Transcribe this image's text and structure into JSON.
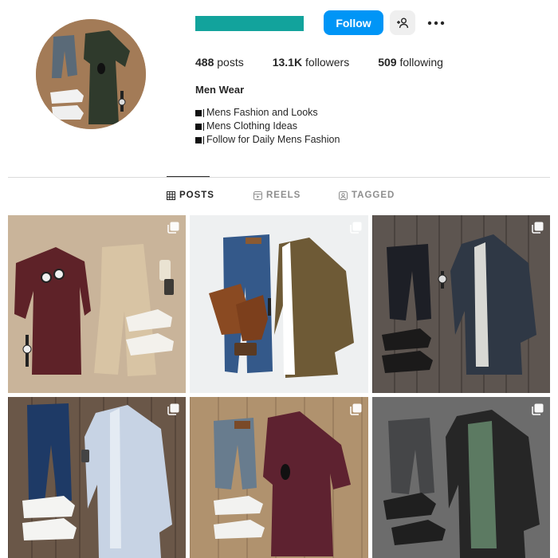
{
  "profile": {
    "username_redacted": true,
    "follow_label": "Follow",
    "stats": {
      "posts_value": "488",
      "posts_label": "posts",
      "followers_value": "13.1K",
      "followers_label": "followers",
      "following_value": "509",
      "following_label": "following"
    },
    "bio": {
      "name": "Men Wear",
      "lines": [
        "Mens Fashion and Looks",
        "Mens Clothing Ideas",
        "Follow for Daily Mens Fashion"
      ]
    }
  },
  "tabs": [
    {
      "label": "POSTS",
      "icon": "grid-icon",
      "active": true
    },
    {
      "label": "REELS",
      "icon": "reels-icon",
      "active": false
    },
    {
      "label": "TAGGED",
      "icon": "tagged-icon",
      "active": false
    }
  ],
  "posts": [
    {
      "icon": "multiple-photos-icon"
    },
    {
      "icon": "multiple-photos-icon"
    },
    {
      "icon": "multiple-photos-icon"
    },
    {
      "icon": "multiple-photos-icon"
    },
    {
      "icon": "multiple-photos-icon"
    },
    {
      "icon": "multiple-photos-icon"
    }
  ],
  "colors": {
    "accent": "#0095f6",
    "username_redaction": "#12a39c",
    "divider": "#dbdbdb",
    "muted_text": "#8e8e8e"
  }
}
